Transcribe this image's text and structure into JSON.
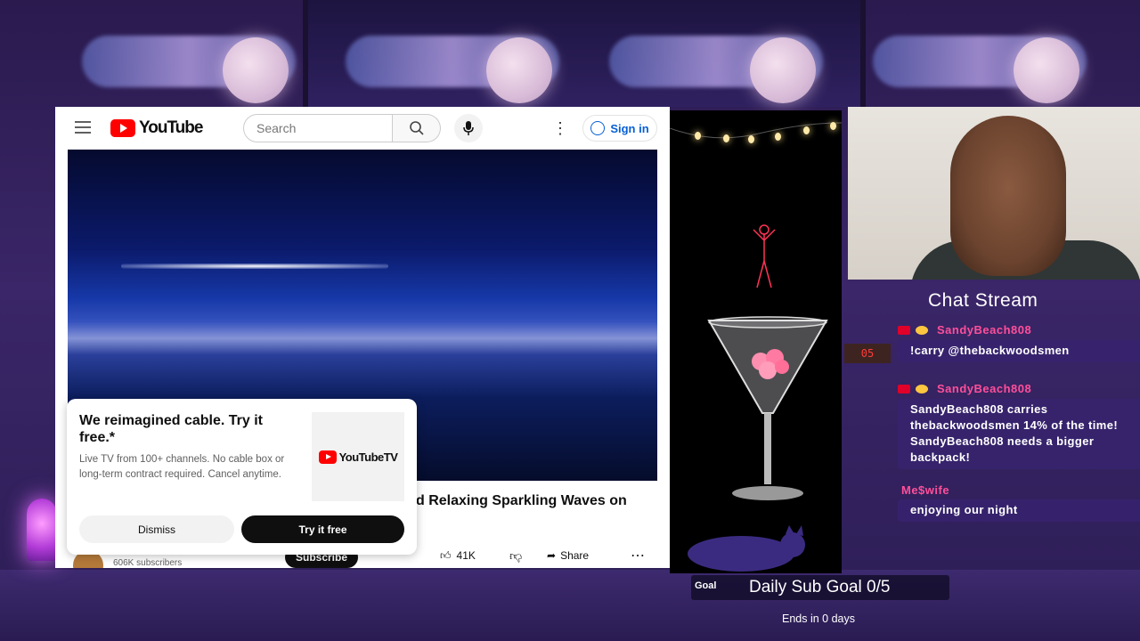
{
  "youtube": {
    "logo_text": "YouTube",
    "search_placeholder": "Search",
    "sign_in_label": "Sign in",
    "video_title_visible": "d Relaxing Sparkling Waves on",
    "subscriber_count": "606K subscribers",
    "subscribe_label": "Subscribe",
    "like_count": "41K",
    "share_label": "Share"
  },
  "promo": {
    "title": "We reimagined cable. Try it free.*",
    "description": "Live TV from 100+ channels. No cable box or long-term contract required. Cancel anytime.",
    "logo_text": "YouTubeTV",
    "dismiss_label": "Dismiss",
    "try_label": "Try it free"
  },
  "chat": {
    "title": "Chat Stream",
    "messages": [
      {
        "user": "SandyBeach808",
        "text": "!carry @thebackwoodsmen"
      },
      {
        "user": "SandyBeach808",
        "text": "SandyBeach808 carries thebackwoodsmen 14% of the time! SandyBeach808 needs a bigger backpack!"
      },
      {
        "user": "Me$wife",
        "text": "enjoying our night"
      }
    ]
  },
  "goal": {
    "label": "Goal",
    "text": "Daily Sub Goal 0/5",
    "ends": "Ends in 0 days"
  },
  "clock": {
    "text": "05"
  },
  "colors": {
    "youtube_red": "#ff0000",
    "chat_username": "#ff4f9a",
    "link_blue": "#065fd4"
  }
}
